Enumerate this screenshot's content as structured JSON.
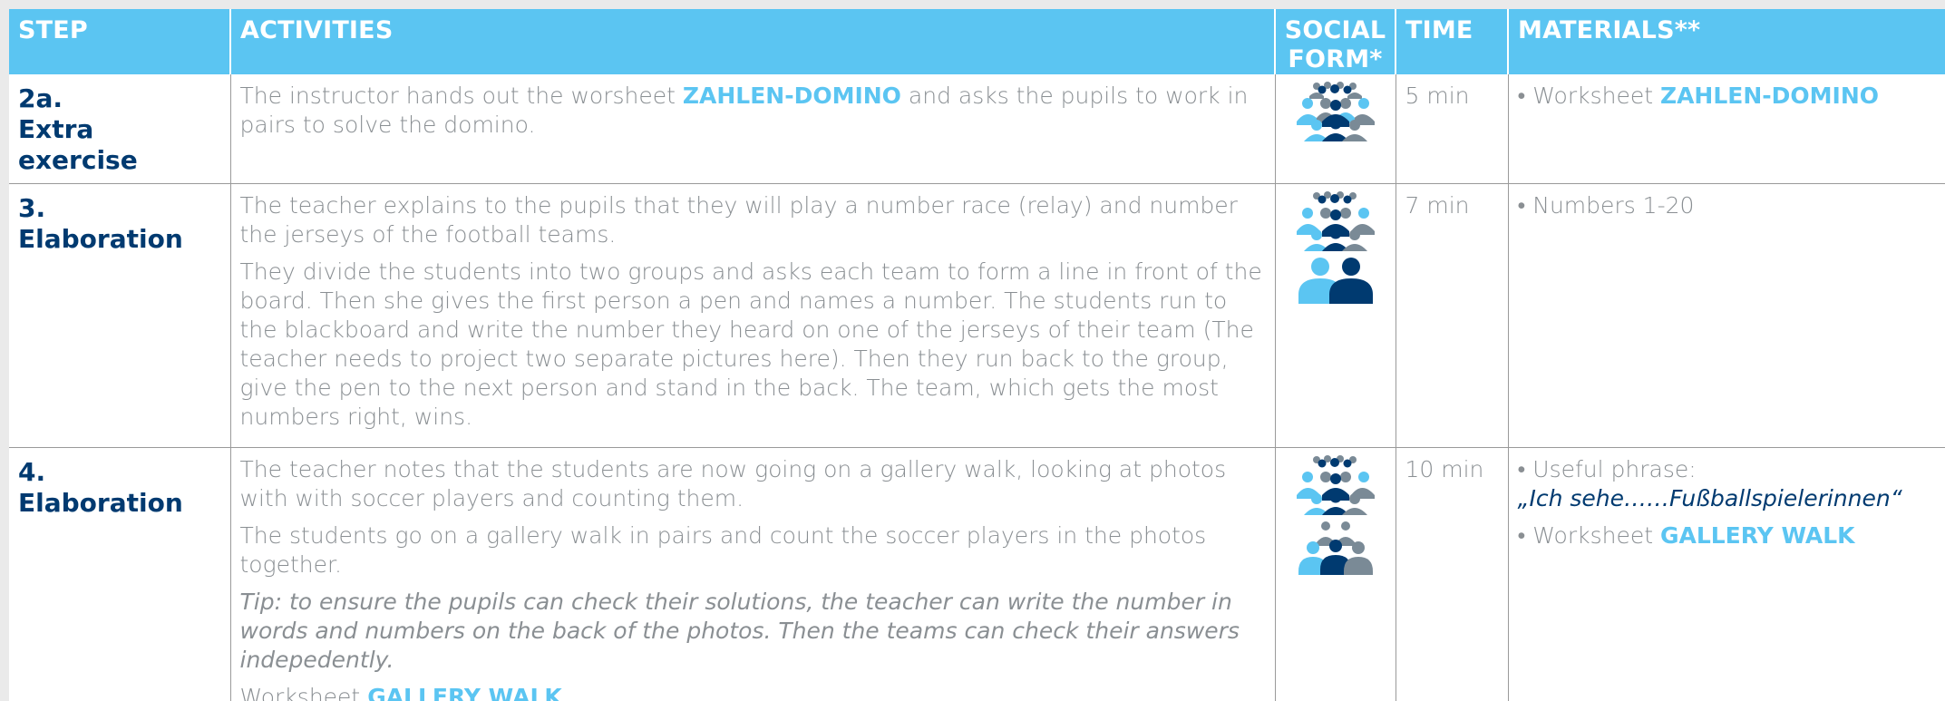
{
  "headers": {
    "step": "STEP",
    "activities": "ACTIVITIES",
    "social_form_line1": "SOCIAL",
    "social_form_line2": "FORM*",
    "time": "TIME",
    "materials": "MATERIALS**"
  },
  "rows": [
    {
      "step_number": "2a.",
      "step_name": "Extra exercise",
      "activity_p1_before": "The instructor hands out the worsheet ",
      "activity_p1_highlight": "ZAHLEN-DOMINO",
      "activity_p1_after": " and asks the pupils to work in pairs to solve the domino.",
      "social_icons": [
        "group-icon"
      ],
      "time": "5 min",
      "materials_bullet": "•",
      "material_1_before": "Worksheet ",
      "material_1_highlight": "ZAHLEN-DOMINO"
    },
    {
      "step_number": "3.",
      "step_name": "Elaboration",
      "activity_p1": "The teacher explains to the pupils that they will play a number race (relay) and number the jerseys of the football teams.",
      "activity_p2": "They divide the students into two groups and asks each team to form a line in front of the board. Then she gives the first person a pen and names a number. The students run to the blackboard and write the number they heard on one of the jerseys of their team (The teacher needs to project two separate pictures here). Then they run back to the group, give the pen to the next person and stand in the back. The team, which gets the most numbers right, wins.",
      "social_icons": [
        "group-icon",
        "pair-icon"
      ],
      "time": "7 min",
      "materials_bullet": "•",
      "material_1": "Numbers 1-20"
    },
    {
      "step_number": "4.",
      "step_name": "Elaboration",
      "activity_p1": "The teacher notes that the students are now going on a gallery walk, looking at photos with with soccer players and counting them.",
      "activity_p2": "The students go on a gallery walk in pairs and count the soccer players in the photos together.",
      "activity_tip": "Tip: to ensure the pupils can check their solutions, the teacher can write the number in words and numbers on the back of the photos. Then the teams can check their answers indepedently.",
      "activity_p4_before": "Worksheet ",
      "activity_p4_highlight": "GALLERY WALK",
      "social_icons": [
        "group-icon",
        "small-group-icon"
      ],
      "time": "10 min",
      "materials_bullet": "•",
      "material_1": "Useful phrase:",
      "material_1_phrase": "„Ich sehe……Fußballspielerinnen“",
      "material_2_before": "Worksheet ",
      "material_2_highlight": "GALLERY WALK"
    }
  ],
  "colors": {
    "header_bg": "#5bc5f2",
    "step_text": "#003a70",
    "body_text": "#8a8f93",
    "highlight": "#5bc5f2",
    "icon_light": "#5bc5f2",
    "icon_dark": "#003a70",
    "icon_gray": "#7a8a96"
  }
}
